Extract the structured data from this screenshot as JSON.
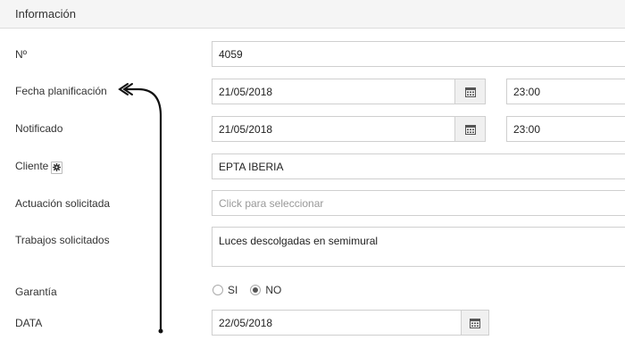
{
  "panel": {
    "title": "Información"
  },
  "fields": {
    "numero": {
      "label": "Nº",
      "value": "4059"
    },
    "fecha_planificacion": {
      "label": "Fecha planificación",
      "date": "21/05/2018",
      "time": "23:00"
    },
    "notificado": {
      "label": "Notificado",
      "date": "21/05/2018",
      "time": "23:00"
    },
    "cliente": {
      "label": "Cliente",
      "value": "EPTA IBERIA"
    },
    "actuacion": {
      "label": "Actuación solicitada",
      "placeholder": "Click para seleccionar"
    },
    "trabajos": {
      "label": "Trabajos solicitados",
      "value": "Luces descolgadas en semimural"
    },
    "garantia": {
      "label": "Garantía",
      "options": [
        "SI",
        "NO"
      ],
      "selected": "NO"
    },
    "data": {
      "label": "DATA",
      "date": "22/05/2018"
    }
  },
  "icons": {
    "calendar": "calendar-icon",
    "gear": "gear-icon",
    "annotation": "arrow-annotation"
  }
}
